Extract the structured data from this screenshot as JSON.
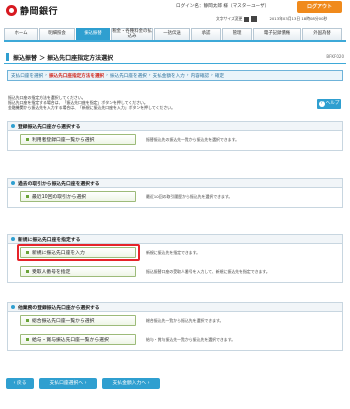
{
  "header": {
    "bank_name": "静岡銀行",
    "login_info": "ログイン名：静岡太郎 様（マスターユーザ）",
    "logout_label": "ログアウト",
    "font_size_label": "文字サイズ変更",
    "datetime": "2013年03月13日 18時08分00秒"
  },
  "nav": {
    "tabs": [
      {
        "label": "ホーム"
      },
      {
        "label": "明細照会"
      },
      {
        "label": "振込振替",
        "active": true
      },
      {
        "label": "税金・各種料金の払込み"
      },
      {
        "label": "一括伝送"
      },
      {
        "label": "承認"
      },
      {
        "label": "管理"
      },
      {
        "label": "電子記録債権"
      },
      {
        "label": "外国為替"
      }
    ]
  },
  "page": {
    "title": "振込振替 ＞ 振込先口座指定方法選択",
    "screen_id": "BFKF020"
  },
  "steps": [
    {
      "label": "支払口座を選択"
    },
    {
      "label": "振込先口座指定方法を選択",
      "current": true
    },
    {
      "label": "振込先口座を選択"
    },
    {
      "label": "支払金額を入力"
    },
    {
      "label": "内容確認"
    },
    {
      "label": "確定"
    }
  ],
  "intro": {
    "line1": "振込先口座の指定方法を選択してください。",
    "line2": "振込先口座を指定する場合は、「振込先口座を指定」ボタンを押してください。",
    "line3": "金融機関から振込先を入力する場合は、「新規に振込先口座を入力」ボタンを押してください。"
  },
  "help_label": "ヘルプ",
  "sections": [
    {
      "title": "登録振込先口座から選択する",
      "options": [
        {
          "button": "利用者登録口座一覧から選択",
          "desc": "振替振込先の振込先一覧から振込先を選択できます。"
        }
      ]
    },
    {
      "title": "過去の取引から振込先口座を選択する",
      "options": [
        {
          "button": "最近10回の取引から選択",
          "desc": "最近10回の取引履歴から振込先を選択できます。"
        }
      ]
    },
    {
      "title": "新規に振込先口座を指定する",
      "options": [
        {
          "button": "新規に振込先口座を入力",
          "desc": "新規に振込先を指定できます。",
          "highlight": true
        },
        {
          "button": "受取人番号を指定",
          "desc": "振込振替口座の受取人番号を入力して、新規に振込先を指定できます。"
        }
      ]
    },
    {
      "title": "他業務の登録振込先口座から選択する",
      "options": [
        {
          "button": "総合振込先口座一覧から選択",
          "desc": "総合振込先一覧から振込先を選択できます。"
        },
        {
          "button": "給与・賞与振込先口座一覧から選択",
          "desc": "給与・賞与振込先一覧から振込先を選択できます。"
        }
      ]
    }
  ],
  "bottom": {
    "back": "戻る",
    "payment_account": "支払口座選択へ",
    "amount_input": "支払金額入力へ"
  },
  "colors": {
    "accent": "#2f9fd0",
    "brand_red": "#d71920",
    "logout": "#f08a1c",
    "highlight": "#e6232a",
    "current_step": "#d0251c"
  }
}
